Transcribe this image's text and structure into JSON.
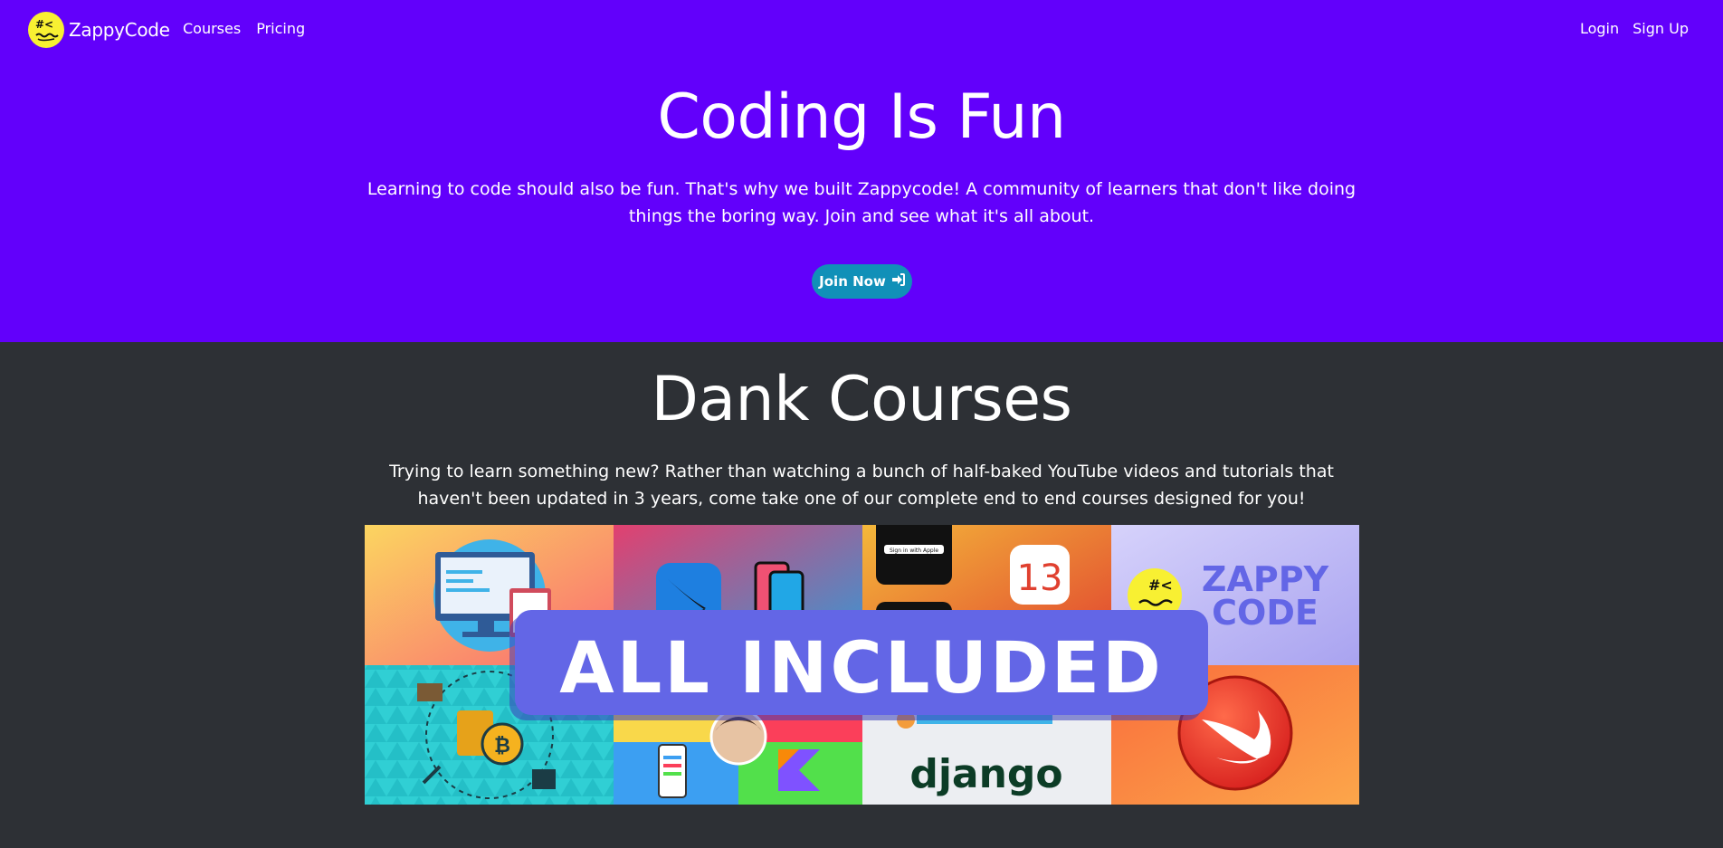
{
  "navbar": {
    "brand": "ZappyCode",
    "logo_glyph": "#<",
    "left_links": [
      "Courses",
      "Pricing"
    ],
    "right_links": [
      "Login",
      "Sign Up"
    ]
  },
  "hero": {
    "title": "Coding Is Fun",
    "text": "Learning to code should also be fun. That's why we built Zappycode! A community of learners that don't like doing things the boring way. Join and see what it's all about.",
    "button_label": "Join Now",
    "button_icon": "sign-in-icon"
  },
  "courses": {
    "title": "Dank Courses",
    "text": "Trying to learn something new? Rather than watching a bunch of half-baked YouTube videos and tutorials that haven't been updated in 3 years, come take one of our complete end to end courses designed for you!",
    "banner": {
      "overlay_text": "ALL INCLUDED",
      "ios_version": "13",
      "brand_text_line1": "ZAPPY",
      "brand_text_line2": "CODE",
      "django_text": "django",
      "sign_in_text": "Sign in with Apple"
    }
  },
  "colors": {
    "hero_bg": "#6200fb",
    "body_bg": "#2d3035",
    "button_bg": "#1190b8",
    "banner_label_bg": "#6366e6"
  }
}
